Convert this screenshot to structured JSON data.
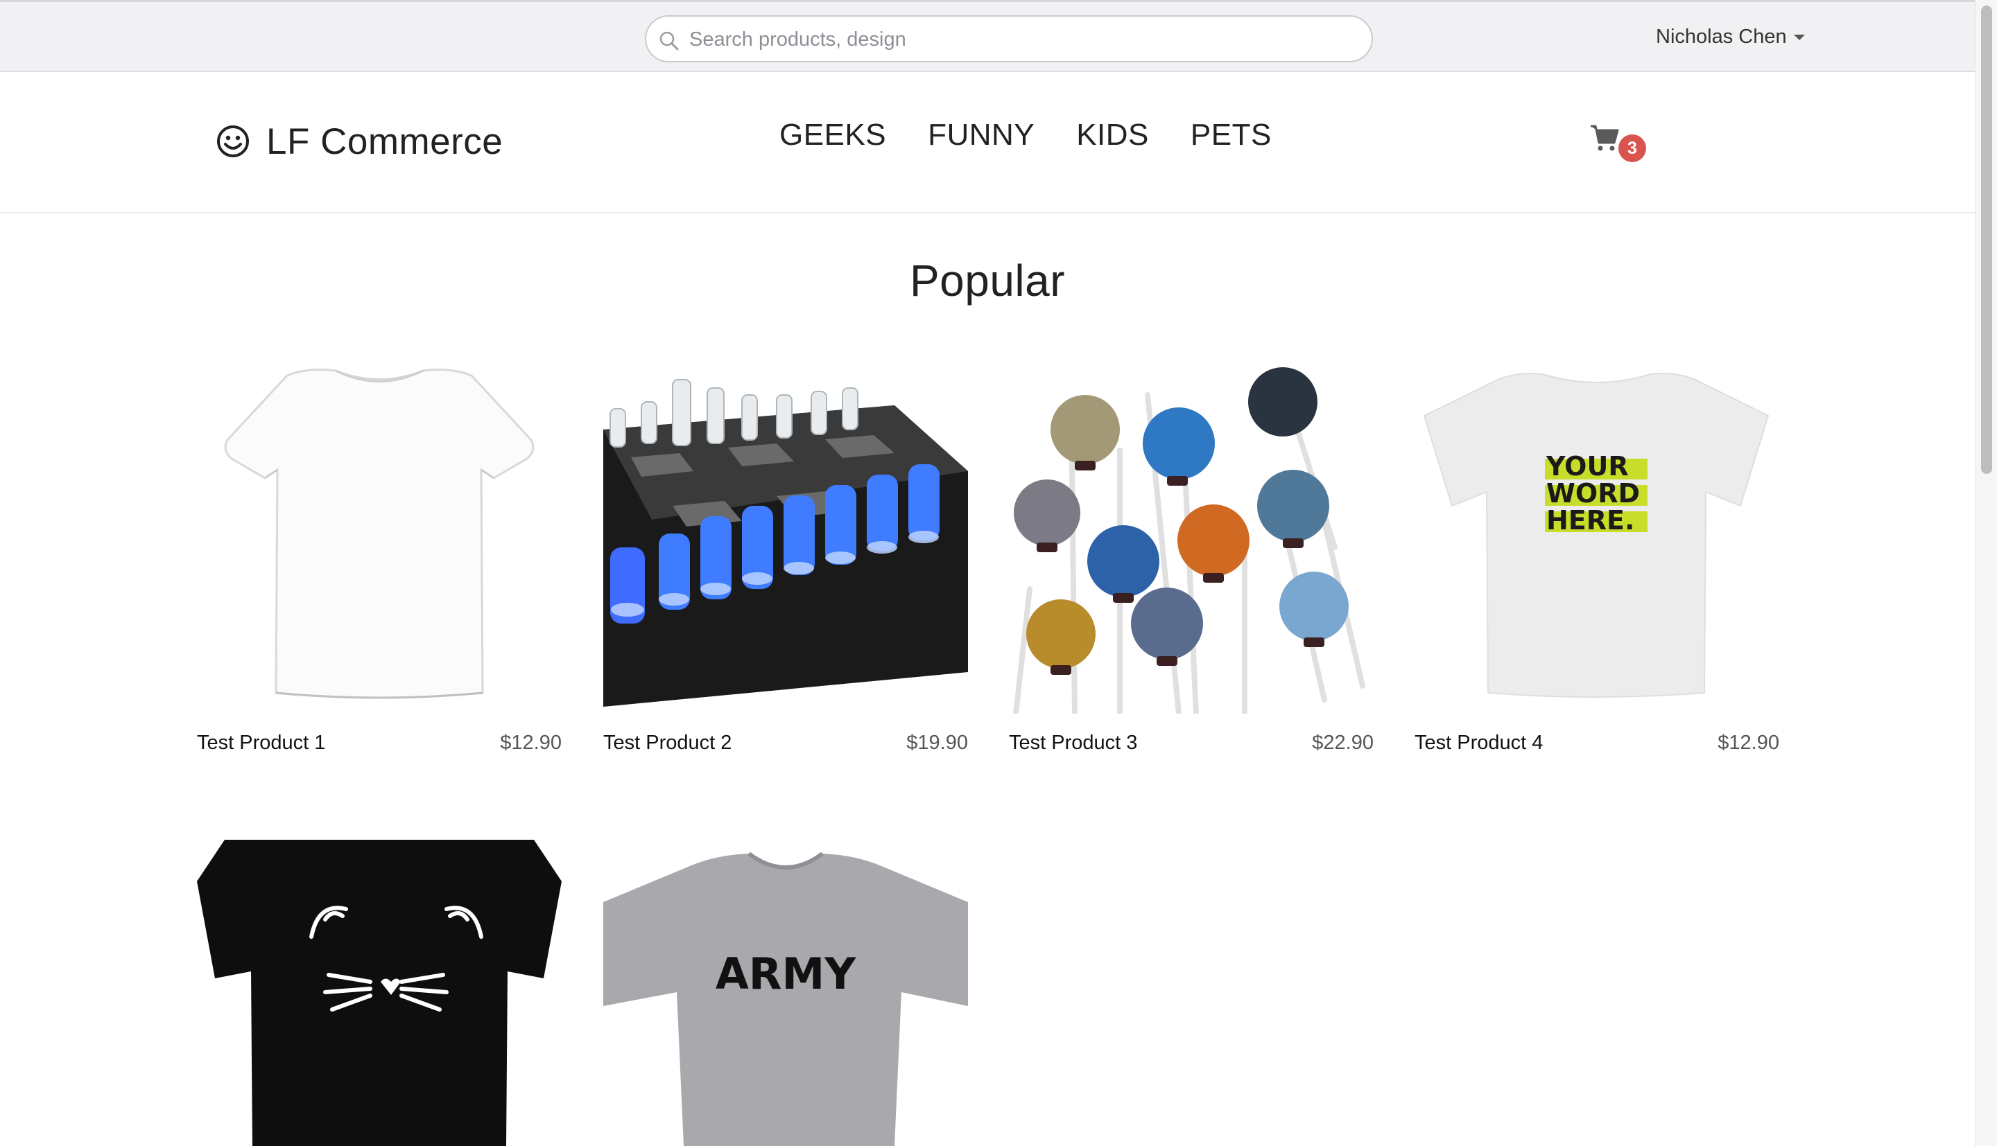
{
  "topbar": {
    "search_placeholder": "Search products, design",
    "user_name": "Nicholas Chen"
  },
  "header": {
    "brand": "LF Commerce",
    "nav": [
      "GEEKS",
      "FUNNY",
      "KIDS",
      "PETS"
    ],
    "cart_count": "3"
  },
  "section": {
    "title": "Popular"
  },
  "products": [
    {
      "name": "Test Product 1",
      "price": "$12.90"
    },
    {
      "name": "Test Product 2",
      "price": "$19.90"
    },
    {
      "name": "Test Product 3",
      "price": "$22.90"
    },
    {
      "name": "Test Product 4",
      "price": "$12.90"
    },
    {
      "name": "",
      "price": ""
    },
    {
      "name": "",
      "price": ""
    }
  ],
  "images": {
    "product_4_print": [
      "YOUR",
      "WORD",
      "HERE."
    ],
    "product_6_print": "ARMY"
  },
  "colors": {
    "badge": "#d9534f",
    "topbar_bg": "#f1f1f4",
    "highlight_green": "#c8dd2a"
  },
  "icons": {
    "search": "search-icon",
    "logo": "smiley-icon",
    "cart": "cart-icon",
    "user_menu": "caret-down-icon"
  }
}
